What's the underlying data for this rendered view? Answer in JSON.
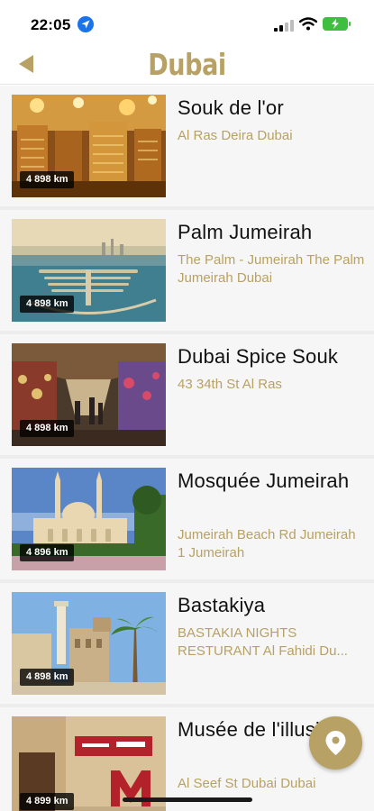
{
  "status_bar": {
    "time": "22:05"
  },
  "header": {
    "title": "Dubai"
  },
  "places": [
    {
      "name": "Souk de l'or",
      "address": "Al Ras Deira Dubai",
      "distance": "4 898 km"
    },
    {
      "name": "Palm Jumeirah",
      "address": "The Palm - Jumeirah The Palm Jumeirah Dubai",
      "distance": "4 898 km"
    },
    {
      "name": "Dubai Spice Souk",
      "address": "43 34th St Al Ras",
      "distance": "4 898 km"
    },
    {
      "name": "Mosquée Jumeirah",
      "address": "Jumeirah Beach Rd Jumeirah 1 Jumeirah",
      "distance": "4 896 km"
    },
    {
      "name": "Bastakiya",
      "address": "BASTAKIA NIGHTS RESTURANT Al Fahidi Du...",
      "distance": "4 898 km"
    },
    {
      "name": "Musée de l'illusion",
      "address": "Al Seef St Dubai Dubai",
      "distance": "4 899 km"
    }
  ],
  "colors": {
    "accent": "#b8a164",
    "card_background": "#f6f6f6",
    "separator": "#ececec"
  },
  "icons": {
    "back": "back-triangle-icon",
    "map": "location-pin-icon",
    "location_services": "location-arrow-icon"
  }
}
